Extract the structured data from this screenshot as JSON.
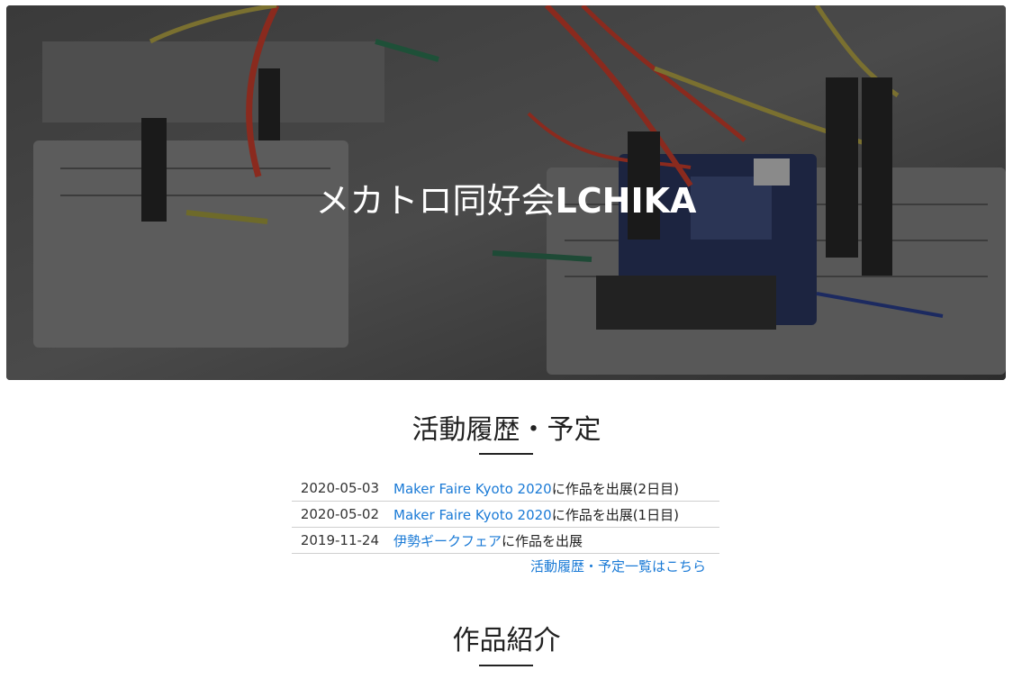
{
  "hero": {
    "title_prefix": "メカトロ同好会",
    "title_brand": "LCHIKA"
  },
  "activity": {
    "heading": "活動履歴・予定",
    "items": [
      {
        "date": "2020-05-03",
        "link": "Maker Faire Kyoto 2020",
        "suffix": "に作品を出展(2日目)"
      },
      {
        "date": "2020-05-02",
        "link": "Maker Faire Kyoto 2020",
        "suffix": "に作品を出展(1日目)"
      },
      {
        "date": "2019-11-24",
        "link": "伊勢ギークフェア",
        "suffix": "に作品を出展"
      }
    ],
    "more_link": "活動履歴・予定一覧はこちら"
  },
  "works": {
    "heading": "作品紹介"
  },
  "colors": {
    "link": "#1a7ad6",
    "text": "#222222"
  }
}
